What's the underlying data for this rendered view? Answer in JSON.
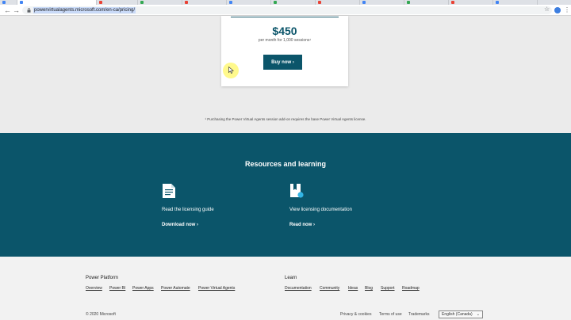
{
  "browser": {
    "url": "powervirtualagents.microsoft.com/en-ca/pricing/",
    "tab_colors": [
      "#4285f4",
      "#4285f4",
      "#e94235",
      "#34a853",
      "#e94235",
      "#4285f4",
      "#34a853",
      "#e94235",
      "#4285f4",
      "#34a853",
      "#e94235"
    ],
    "icons": {
      "back": "arrow-left-icon",
      "forward": "arrow-right-icon",
      "lock": "lock-icon",
      "star": "star-icon",
      "menu": "menu-dots-icon"
    }
  },
  "pricing": {
    "price": "$450",
    "subtitle": "per month for 1,000 sessions¹",
    "buy_label": "Buy now",
    "footnote": "¹ Purchasing the Power Virtual Agents session add-on requires the base Power Virtual Agents license."
  },
  "resources": {
    "title": "Resources and learning",
    "items": [
      {
        "icon": "document-icon",
        "label": "Read the licensing guide",
        "link": "Download now"
      },
      {
        "icon": "bookmark-docs-icon",
        "label": "View licensing documentation",
        "link": "Read now"
      }
    ]
  },
  "footer": {
    "platform": {
      "heading": "Power Platform",
      "links": [
        "Overview",
        "Power BI",
        "Power Apps",
        "Power Automate",
        "Power Virtual Agents"
      ]
    },
    "learn": {
      "heading": "Learn",
      "links": [
        "Documentation",
        "Community",
        "Ideas",
        "Blog",
        "Support",
        "Roadmap"
      ]
    },
    "bottom": {
      "copyright": "© 2020 Microsoft",
      "privacy": "Privacy & cookies",
      "terms": "Terms of use",
      "trademarks": "Trademarks",
      "language": "English (Canada)"
    }
  },
  "colors": {
    "brand_teal": "#0b556a",
    "cursor_highlight": "#fff878"
  }
}
